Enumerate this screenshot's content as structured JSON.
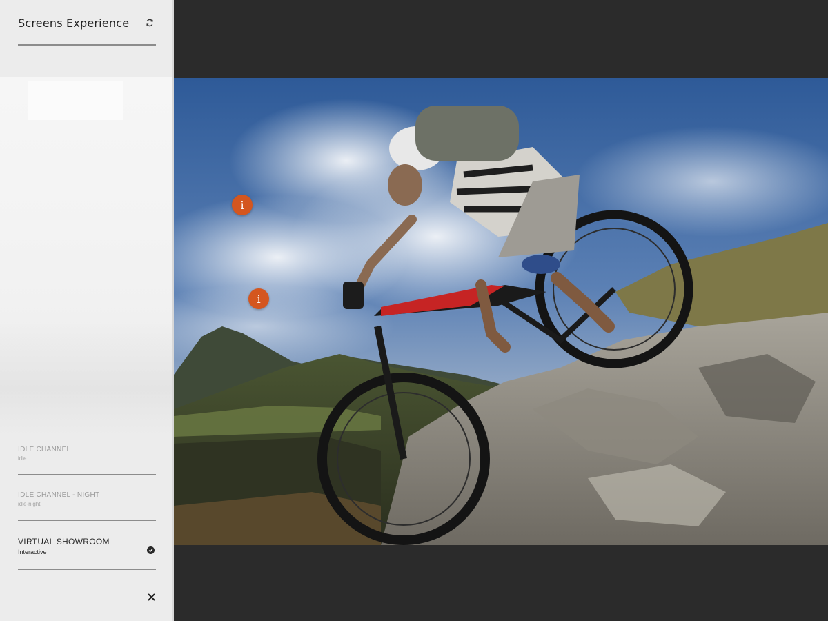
{
  "app": {
    "title": "Screens Experience"
  },
  "channels": [
    {
      "title": "IDLE CHANNEL",
      "subtitle": "idle"
    },
    {
      "title": "IDLE CHANNEL - NIGHT",
      "subtitle": "idle-night"
    },
    {
      "title": "VIRTUAL SHOWROOM",
      "subtitle": "Interactive"
    }
  ],
  "icons": {
    "refresh": "refresh-icon",
    "selected": "check-circle-icon",
    "close": "close-icon",
    "hotspot": "info-icon"
  },
  "hotspots": [
    {
      "label": "i"
    },
    {
      "label": "i"
    }
  ],
  "colors": {
    "accent": "#d4561f",
    "panel": "#ececec",
    "stage": "#2b2b2b"
  }
}
